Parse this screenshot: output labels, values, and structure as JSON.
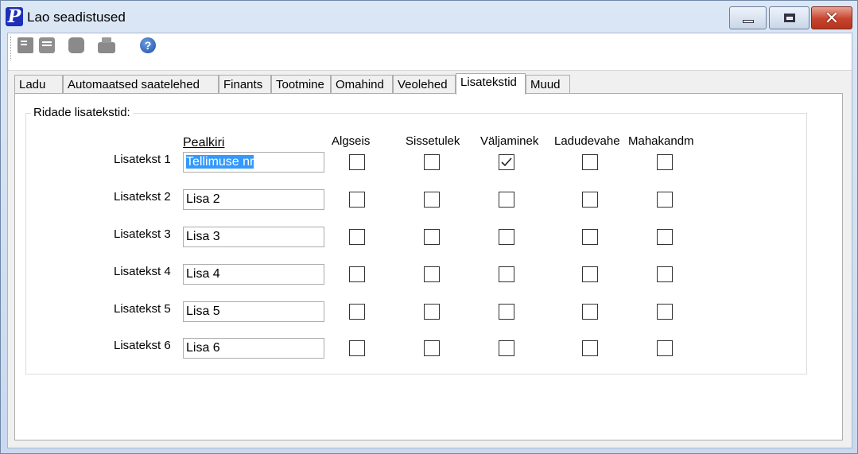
{
  "window": {
    "title": "Lao seadistused",
    "app_icon_glyph": "P",
    "close_glyph": "✕"
  },
  "toolbar": {
    "icons": [
      "new-document-icon",
      "list-icon",
      "stop-icon",
      "print-icon",
      "help-icon"
    ],
    "help_glyph": "?"
  },
  "tabs": [
    {
      "label": "Ladu",
      "active": false
    },
    {
      "label": "Automaatsed saatelehed",
      "active": false
    },
    {
      "label": "Finants",
      "active": false
    },
    {
      "label": "Tootmine",
      "active": false
    },
    {
      "label": "Omahind",
      "active": false
    },
    {
      "label": "Veolehed",
      "active": false
    },
    {
      "label": "Lisatekstid",
      "active": true
    },
    {
      "label": "Muud",
      "active": false
    }
  ],
  "group": {
    "legend": "Ridade lisatekstid:",
    "columns": {
      "pealkiri": "Pealkiri",
      "algseis": "Algseis",
      "sissetulek": "Sissetulek",
      "valjaminek": "Väljaminek",
      "ladudevahe": "Ladudevahe",
      "mahakandm": "Mahakandm"
    },
    "rows": [
      {
        "label": "Lisatekst 1",
        "value": "Tellimuse nr",
        "selected": true,
        "checks": [
          false,
          false,
          true,
          false,
          false
        ]
      },
      {
        "label": "Lisatekst 2",
        "value": "Lisa 2",
        "selected": false,
        "checks": [
          false,
          false,
          false,
          false,
          false
        ]
      },
      {
        "label": "Lisatekst 3",
        "value": "Lisa 3",
        "selected": false,
        "checks": [
          false,
          false,
          false,
          false,
          false
        ]
      },
      {
        "label": "Lisatekst 4",
        "value": "Lisa 4",
        "selected": false,
        "checks": [
          false,
          false,
          false,
          false,
          false
        ]
      },
      {
        "label": "Lisatekst 5",
        "value": "Lisa 5",
        "selected": false,
        "checks": [
          false,
          false,
          false,
          false,
          false
        ]
      },
      {
        "label": "Lisatekst 6",
        "value": "Lisa 6",
        "selected": false,
        "checks": [
          false,
          false,
          false,
          false,
          false
        ]
      }
    ]
  },
  "colors": {
    "selection": "#3399ff",
    "close_button": "#c7432c",
    "titlebar": "#dbe7f5"
  }
}
